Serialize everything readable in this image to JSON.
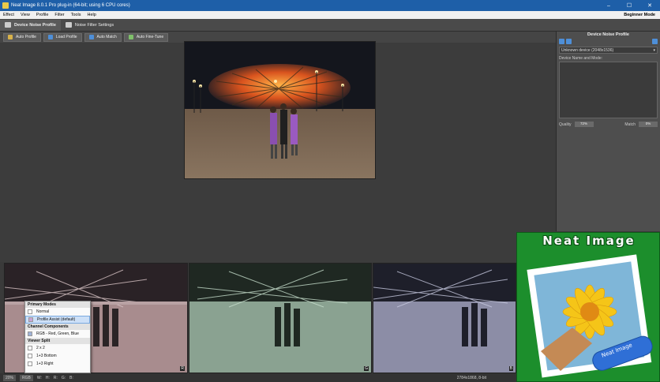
{
  "window": {
    "title": "Neat Image 8.0.1 Pro plug-in (64-bit; using 6 CPU cores)",
    "minimize": "–",
    "maximize": "☐",
    "close": "✕"
  },
  "menu": {
    "items": [
      "Effect",
      "View",
      "Profile",
      "Filter",
      "Tools",
      "Help"
    ],
    "mode": "Beginner Mode"
  },
  "tabs": [
    {
      "label": "Device Noise Profile",
      "active": true
    },
    {
      "label": "Noise Filter Settings",
      "active": false
    }
  ],
  "toolbar": {
    "buttons": [
      {
        "label": "Auto Profile",
        "color": "#d8b24a"
      },
      {
        "label": "Load Profile",
        "color": "#4e8fd8"
      },
      {
        "label": "Auto Match",
        "color": "#4e8fd8"
      },
      {
        "label": "Auto Fine-Tune",
        "color": "#7fc06a"
      }
    ]
  },
  "panel": {
    "title": "Device Noise Profile",
    "device_select": "Unknown device (2048x1536)",
    "name_label": "Device Name and Mode:",
    "quality_label": "Quality",
    "quality_value": "72%",
    "match_label": "Match",
    "match_value": "0%"
  },
  "channels": [
    {
      "letter": "R",
      "tint": "#c89aa0"
    },
    {
      "letter": "G",
      "tint": "#8fc49b"
    },
    {
      "letter": "B",
      "tint": "#8d8fc4"
    }
  ],
  "popup": {
    "sections": [
      {
        "title": "Primary Modes",
        "options": [
          {
            "label": "Normal",
            "selected": false
          },
          {
            "label": "Profile Assist (default)",
            "selected": true
          }
        ]
      },
      {
        "title": "Channel Components",
        "options": [
          {
            "label": "RGB - Red, Green, Blue",
            "selected": false
          }
        ]
      },
      {
        "title": "Viewer Split",
        "options": [
          {
            "label": "2 x 2",
            "selected": false
          },
          {
            "label": "1+3 Bottom",
            "selected": false
          },
          {
            "label": "1+3 Right",
            "selected": false
          }
        ]
      }
    ]
  },
  "status": {
    "zoom": "20%",
    "mode": "RGB",
    "w_label": "W:",
    "h_label": "H:",
    "r_label": "R:",
    "g_label": "G:",
    "b_label": "B:",
    "dims": "2784x1868, 8-bit"
  },
  "logo": {
    "title": "Neat Image",
    "badge": "Neat Image",
    "accent": "#1c8e2c"
  }
}
